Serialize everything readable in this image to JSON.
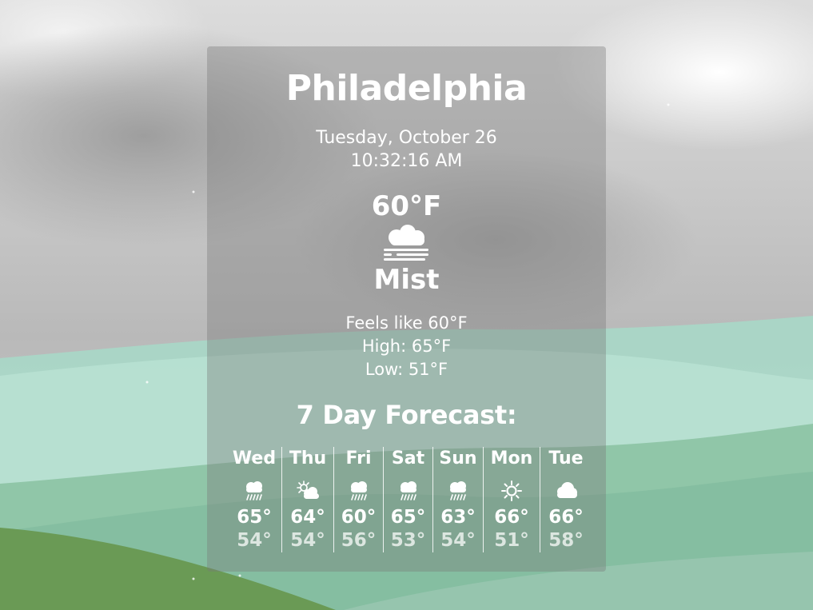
{
  "location": {
    "city": "Philadelphia",
    "date": "Tuesday, October 26",
    "time": "10:32:16 AM"
  },
  "current": {
    "temperature": "60°F",
    "icon": "mist-icon",
    "condition": "Mist",
    "feels_like": "Feels like 60°F",
    "high": "High: 65°F",
    "low": "Low: 51°F"
  },
  "forecast": {
    "title": "7 Day Forecast:",
    "days": [
      {
        "day": "Wed",
        "icon": "rain-cloud-icon",
        "high": "65°",
        "low": "54°"
      },
      {
        "day": "Thu",
        "icon": "partly-sunny-icon",
        "high": "64°",
        "low": "54°"
      },
      {
        "day": "Fri",
        "icon": "rain-cloud-icon",
        "high": "60°",
        "low": "56°"
      },
      {
        "day": "Sat",
        "icon": "rain-cloud-icon",
        "high": "65°",
        "low": "53°"
      },
      {
        "day": "Sun",
        "icon": "rain-cloud-icon",
        "high": "63°",
        "low": "54°"
      },
      {
        "day": "Mon",
        "icon": "sun-icon",
        "high": "66°",
        "low": "51°"
      },
      {
        "day": "Tue",
        "icon": "cloud-icon",
        "high": "66°",
        "low": "58°"
      }
    ]
  },
  "colors": {
    "text": "#ffffff",
    "card": "#787878",
    "hill_light": "#b5dfcf",
    "hill_mid": "#8fc4a6",
    "hill_dark": "#6a9a55"
  }
}
